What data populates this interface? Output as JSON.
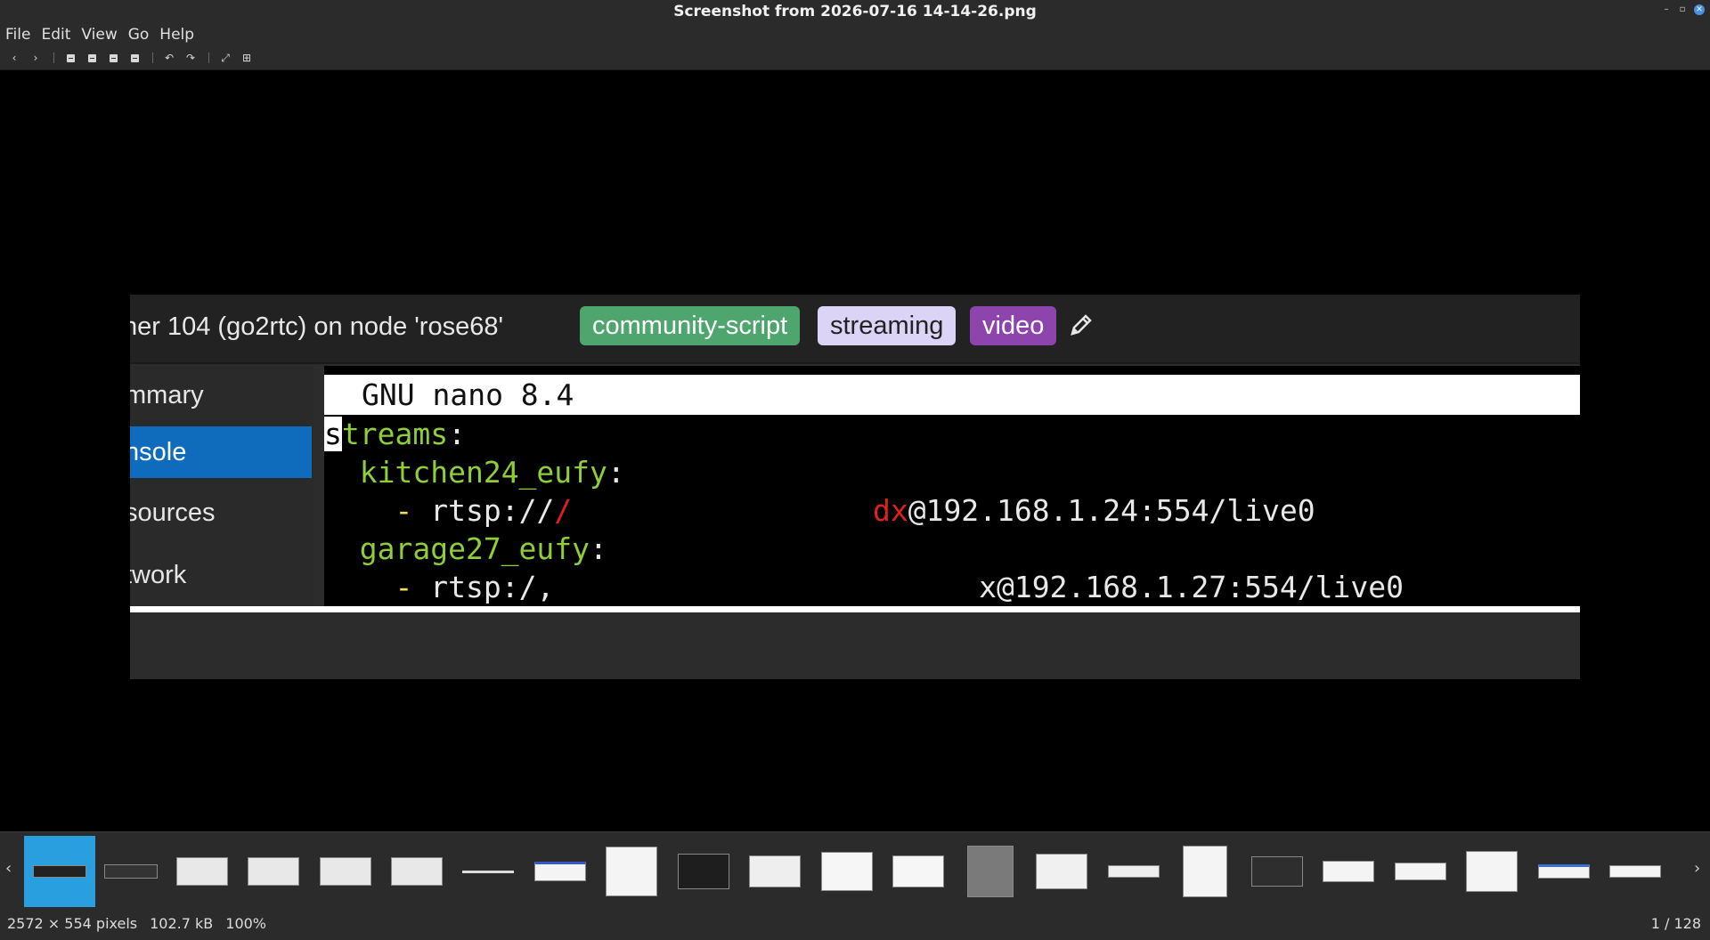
{
  "window": {
    "title": "Screenshot from 2026-07-16 14-14-26.png"
  },
  "menu": [
    "File",
    "Edit",
    "View",
    "Go",
    "Help"
  ],
  "toolbar": {
    "buttons": [
      "back-icon",
      "forward-icon",
      "zoom-out-icon",
      "zoom-in-icon",
      "zoom-normal-icon",
      "zoom-fit-icon",
      "rotate-left-icon",
      "rotate-right-icon",
      "fullscreen-icon",
      "slideshow-icon"
    ]
  },
  "image": {
    "header_title": "ner 104 (go2rtc) on node 'rose68'",
    "tags": [
      "community-script",
      "streaming",
      "video"
    ],
    "sidebar": [
      "mmary",
      "nsole",
      "sources",
      "twork"
    ],
    "active_sidebar": "nsole",
    "terminal": {
      "title": "GNU nano 8.4",
      "line1_cursor": "s",
      "line1_rest": "treams",
      "line1_colon": ":",
      "line2_key": "kitchen24_eufy",
      "line2_colon": ":",
      "line3_dash": "-",
      "line3_scheme": "rtsp://",
      "line3_red1": "/",
      "line3_red2": "dx",
      "line3_host": "@192.168.1.24:554/live0",
      "line4_key": "garage27_eufy",
      "line4_colon": ":",
      "line5_dash": "-",
      "line5_scheme": "rtsp:/,",
      "line5_frag": "x@192.168.1.27:554/live0"
    }
  },
  "status": {
    "dimensions": "2572 × 554 pixels",
    "filesize": "102.7 kB",
    "zoom": "100%",
    "position": "1 / 128"
  },
  "colors": {
    "tag_community": "#4fa56e",
    "tag_streaming": "#dcd4f7",
    "tag_video": "#8e44ad",
    "active_nav": "#0f6cbd",
    "thumb_selected": "#2a9fe0"
  }
}
